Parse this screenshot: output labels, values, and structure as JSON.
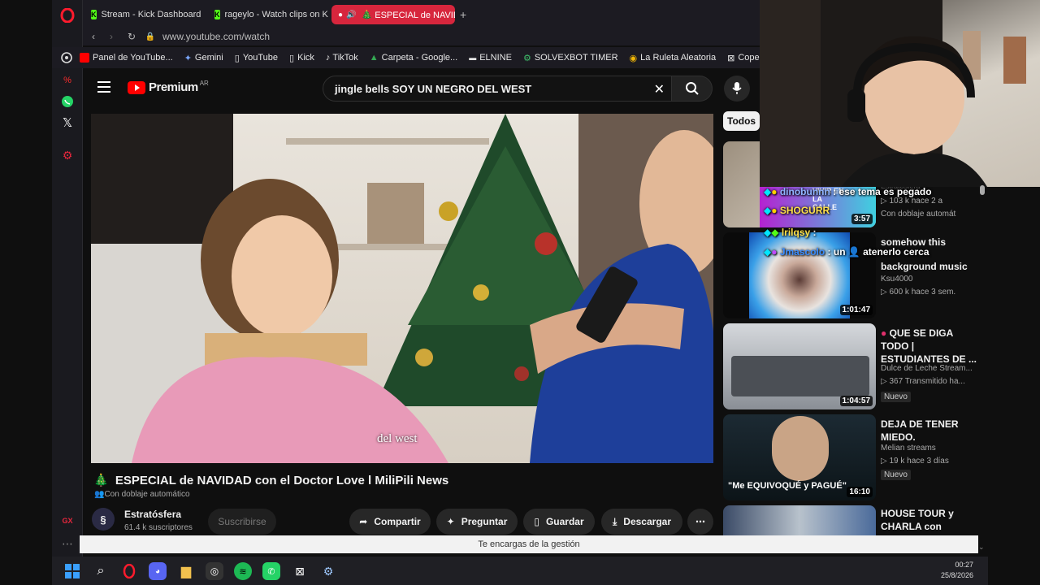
{
  "browser": {
    "tabs": [
      {
        "label": "Stream - Kick Dashboard"
      },
      {
        "label": "rageylo - Watch clips on K"
      },
      {
        "label": "🎄 ESPECIAL de NAVID"
      }
    ],
    "url": "www.youtube.com/watch",
    "bookmarks": [
      {
        "label": "Panel de YouTube..."
      },
      {
        "label": "Gemini"
      },
      {
        "label": "YouTube"
      },
      {
        "label": "Kick"
      },
      {
        "label": "TikTok"
      },
      {
        "label": "Carpeta - Google..."
      },
      {
        "label": "ELNINE"
      },
      {
        "label": "SOLVEXBOT TIMER"
      },
      {
        "label": "La Ruleta Aleatoria"
      },
      {
        "label": "Copero"
      }
    ]
  },
  "youtube": {
    "logo": "Premium",
    "region": "AR",
    "search_value": "jingle bells SOY UN NEGRO DEL WEST",
    "subtitle": "del west",
    "video_title": "ESPECIAL de NAVIDAD con el Doctor Love l MiliPili News",
    "title_emoji": "🎄",
    "dubbing": "Con doblaje automático",
    "channel": {
      "name": "Estratósfera",
      "subs": "61.4 k suscriptores"
    },
    "subscribe_label": "Suscribirse",
    "actions": {
      "share": "Compartir",
      "ask": "Preguntar",
      "save": "Guardar",
      "download": "Descargar"
    },
    "chip": "Todos"
  },
  "recommendations": [
    {
      "title": "",
      "channel": "Estratósfera",
      "views": "103 k",
      "age": "hace 2 a",
      "extra": "Con doblaje automát",
      "duration": "3:57"
    },
    {
      "title": "somehow this song makes me cry",
      "channel": "Ksu4000",
      "views": "600 k",
      "age": "hace 3 sem.",
      "duration": "1:01:47",
      "title_visible": "somehow this",
      "title_line3": "background music"
    },
    {
      "title": "QUE SE DIGA TODO | ESTUDIANTES DE ...",
      "channel": "Dulce de Leche Stream...",
      "views": "367",
      "age": "Transmitido ha...",
      "badge": "Nuevo",
      "duration": "1:04:57"
    },
    {
      "title": "DEJA DE TENER MIEDO.",
      "channel": "Melian streams",
      "views": "19 k",
      "age": "hace 3 días",
      "badge": "Nuevo",
      "duration": "16:10",
      "overlay": "\"Me EQUIVOQUÉ y PAGUÉ\""
    },
    {
      "title": "HOUSE TOUR y CHARLA con DAVOO",
      "channel": "",
      "duration": ""
    }
  ],
  "chat": [
    {
      "user": "dinobunnn",
      "message": "ese tema es pegado"
    },
    {
      "user": "SHOGURR",
      "message": ""
    },
    {
      "user": "lrilqsy",
      "message": ":"
    },
    {
      "user": "Jmascolo",
      "message": ": un 👤 atenerlo cerca"
    }
  ],
  "chat_overlay_text": "VIVIR EN LA CALLE",
  "statusbar": "Te encargas de la gestión",
  "taskbar": {
    "time": "00:27",
    "date": "25/8/2026"
  },
  "colors": {
    "accent": "#d7263d",
    "kick": "#53fc18",
    "yt_red": "#ff0000"
  }
}
